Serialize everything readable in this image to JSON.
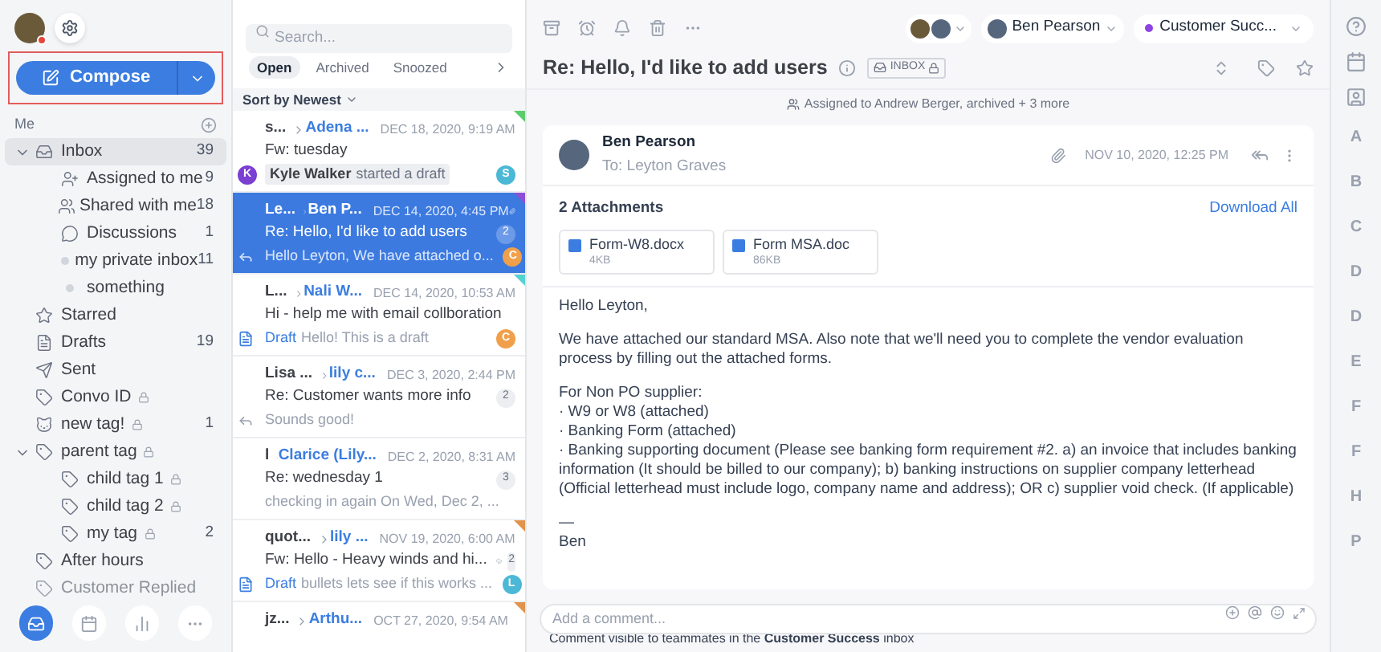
{
  "sidebar": {
    "compose": {
      "label": "Compose"
    },
    "section_label": "Me",
    "folders": [
      {
        "label": "Inbox",
        "kind": "inbox",
        "count": "39",
        "selected": true,
        "expanded": true,
        "children": [
          {
            "label": "Assigned to me",
            "kind": "assigned",
            "count": "9",
            "selected": false
          },
          {
            "label": "Shared with me",
            "kind": "shared",
            "count": "18",
            "selected": false
          },
          {
            "label": "Discussions",
            "kind": "discussion",
            "count": "1",
            "selected": false
          },
          {
            "label": "my private inbox",
            "kind": "dot",
            "count": "11",
            "selected": false
          },
          {
            "label": "something",
            "kind": "dot",
            "selected": false
          }
        ]
      },
      {
        "label": "Starred",
        "kind": "star",
        "selected": false
      },
      {
        "label": "Drafts",
        "kind": "draft",
        "count": "19",
        "selected": false
      },
      {
        "label": "Sent",
        "kind": "sent",
        "selected": false
      },
      {
        "label": "Convo ID",
        "kind": "tag",
        "locked": true,
        "selected": false
      },
      {
        "label": "new tag!",
        "kind": "cat",
        "locked": true,
        "count": "1",
        "selected": false
      },
      {
        "label": "parent tag",
        "kind": "tag",
        "locked": true,
        "selected": false,
        "expanded": true,
        "children": [
          {
            "label": "child tag 1",
            "kind": "tag",
            "locked": true,
            "selected": false
          },
          {
            "label": "child tag 2",
            "kind": "tag",
            "locked": true,
            "selected": false
          },
          {
            "label": "my tag",
            "kind": "tag",
            "locked": true,
            "count": "2",
            "selected": false
          }
        ]
      },
      {
        "label": "After hours",
        "kind": "tag",
        "selected": false
      },
      {
        "label": "Customer Replied",
        "kind": "tag",
        "selected": false,
        "faded": true
      }
    ],
    "bottom_nav": [
      {
        "kind": "inbox",
        "selected": true
      },
      {
        "kind": "calendar",
        "selected": false
      },
      {
        "kind": "chart",
        "selected": false
      },
      {
        "kind": "more",
        "selected": false
      }
    ]
  },
  "list": {
    "search": {
      "placeholder": "Search..."
    },
    "tabs": [
      {
        "label": "Open",
        "selected": true
      },
      {
        "label": "Archived",
        "selected": false
      },
      {
        "label": "Snoozed",
        "selected": false
      }
    ],
    "sort": "Sort by Newest",
    "conversations": [
      {
        "sender": "s...",
        "recipient": "Adena ...",
        "date": "DEC 18, 2020, 9:19 AM",
        "subject": "Fw: tuesday",
        "kind": "activity",
        "activity_avatar": {
          "letter": "K",
          "color": "#7b3fd1"
        },
        "activity_name": "Kyle Walker",
        "preview": "started a draft",
        "avatar": {
          "letter": "S",
          "color": "#4bb8d6"
        },
        "color": "#5ccc6a",
        "selected": false
      },
      {
        "sender": "Le...",
        "recipient": "Ben P...",
        "date": "DEC 14, 2020, 4:45 PM",
        "attachment": true,
        "subject": "Re: Hello, I'd like to add users",
        "count": "2",
        "kind": "reply",
        "preview": "Hello Leyton, We have attached o...",
        "avatar": {
          "letter": "C",
          "color": "#f0a04b"
        },
        "color": "#8e4fd6",
        "selected": true
      },
      {
        "sender": "L...",
        "recipient": "Nali W...",
        "date": "DEC 14, 2020, 10:53 AM",
        "subject": "Hi - help me with email collboration",
        "kind": "draft",
        "draft_label": "Draft",
        "preview": "Hello! This is a draft",
        "avatar": {
          "letter": "C",
          "color": "#f0a04b"
        },
        "color": "#56d1d1",
        "selected": false
      },
      {
        "sender": "Lisa ...",
        "recipient": "lily c...",
        "date": "DEC 3, 2020, 2:44 PM",
        "subject": "Re: Customer wants more info",
        "count": "2",
        "kind": "reply",
        "preview": "Sounds good!",
        "selected": false
      },
      {
        "sender": "l",
        "recipient": "Clarice (Lily...",
        "date": "DEC 2, 2020, 8:31 AM",
        "subject": "Re: wednesday 1",
        "count": "3",
        "kind": "plain",
        "preview": "checking in again On Wed, Dec 2, ...",
        "selected": false
      },
      {
        "sender": "quot...",
        "recipient": "lily ...",
        "date": "NOV 19, 2020, 6:00 AM",
        "subject": "Fw: Hello - Heavy winds and hi...",
        "weather": true,
        "count": "2",
        "kind": "draft",
        "draft_label": "Draft",
        "preview": "bullets lets see if this works ...",
        "avatar": {
          "letter": "L",
          "color": "#4bb8d6"
        },
        "color": "#e0934a",
        "selected": false
      },
      {
        "sender": "jz...",
        "recipient": "Arthu...",
        "date": "OCT 27, 2020, 9:54 AM",
        "color": "#e0934a",
        "selected": false
      }
    ]
  },
  "conversation": {
    "assignee_pill": {
      "name": "Ben Pearson"
    },
    "inbox_pill": {
      "label": "Customer Succ...",
      "color": "#8e44e0"
    },
    "title": "Re: Hello, I'd like to add users",
    "inbox_tag": "INBOX",
    "activity": "Assigned to Andrew Berger, archived + 3 more",
    "message": {
      "sender": "Ben Pearson",
      "to": "To: Leyton Graves",
      "date": "NOV 10, 2020, 12:25 PM",
      "attachments_title": "2 Attachments",
      "download_all": "Download All",
      "attachments": [
        {
          "name": "Form-W8.docx",
          "size": "4KB"
        },
        {
          "name": "Form MSA.doc",
          "size": "86KB"
        }
      ],
      "body": [
        [
          "Hello Leyton,"
        ],
        [
          "We have attached our standard MSA. Also note that we'll need you to complete the vendor evaluation process by filling out the attached forms."
        ],
        [
          "For Non PO supplier:",
          "· W9 or W8 (attached)",
          "· Banking Form (attached)",
          "· Banking supporting document (Please see banking form requirement #2. a) an invoice that includes banking information (It should be billed to our company); b) banking instructions on supplier company letterhead (Official letterhead must include logo, company name and address); OR c) supplier void check. (If applicable)"
        ],
        [
          "—",
          "Ben"
        ]
      ]
    },
    "comment": {
      "placeholder": "Add a comment...",
      "note": "Comment visible to teammates in the **Customer Success** inbox"
    }
  },
  "rail": {
    "letters": [
      "A",
      "B",
      "C",
      "D",
      "D",
      "E",
      "F",
      "F",
      "H",
      "P"
    ]
  }
}
